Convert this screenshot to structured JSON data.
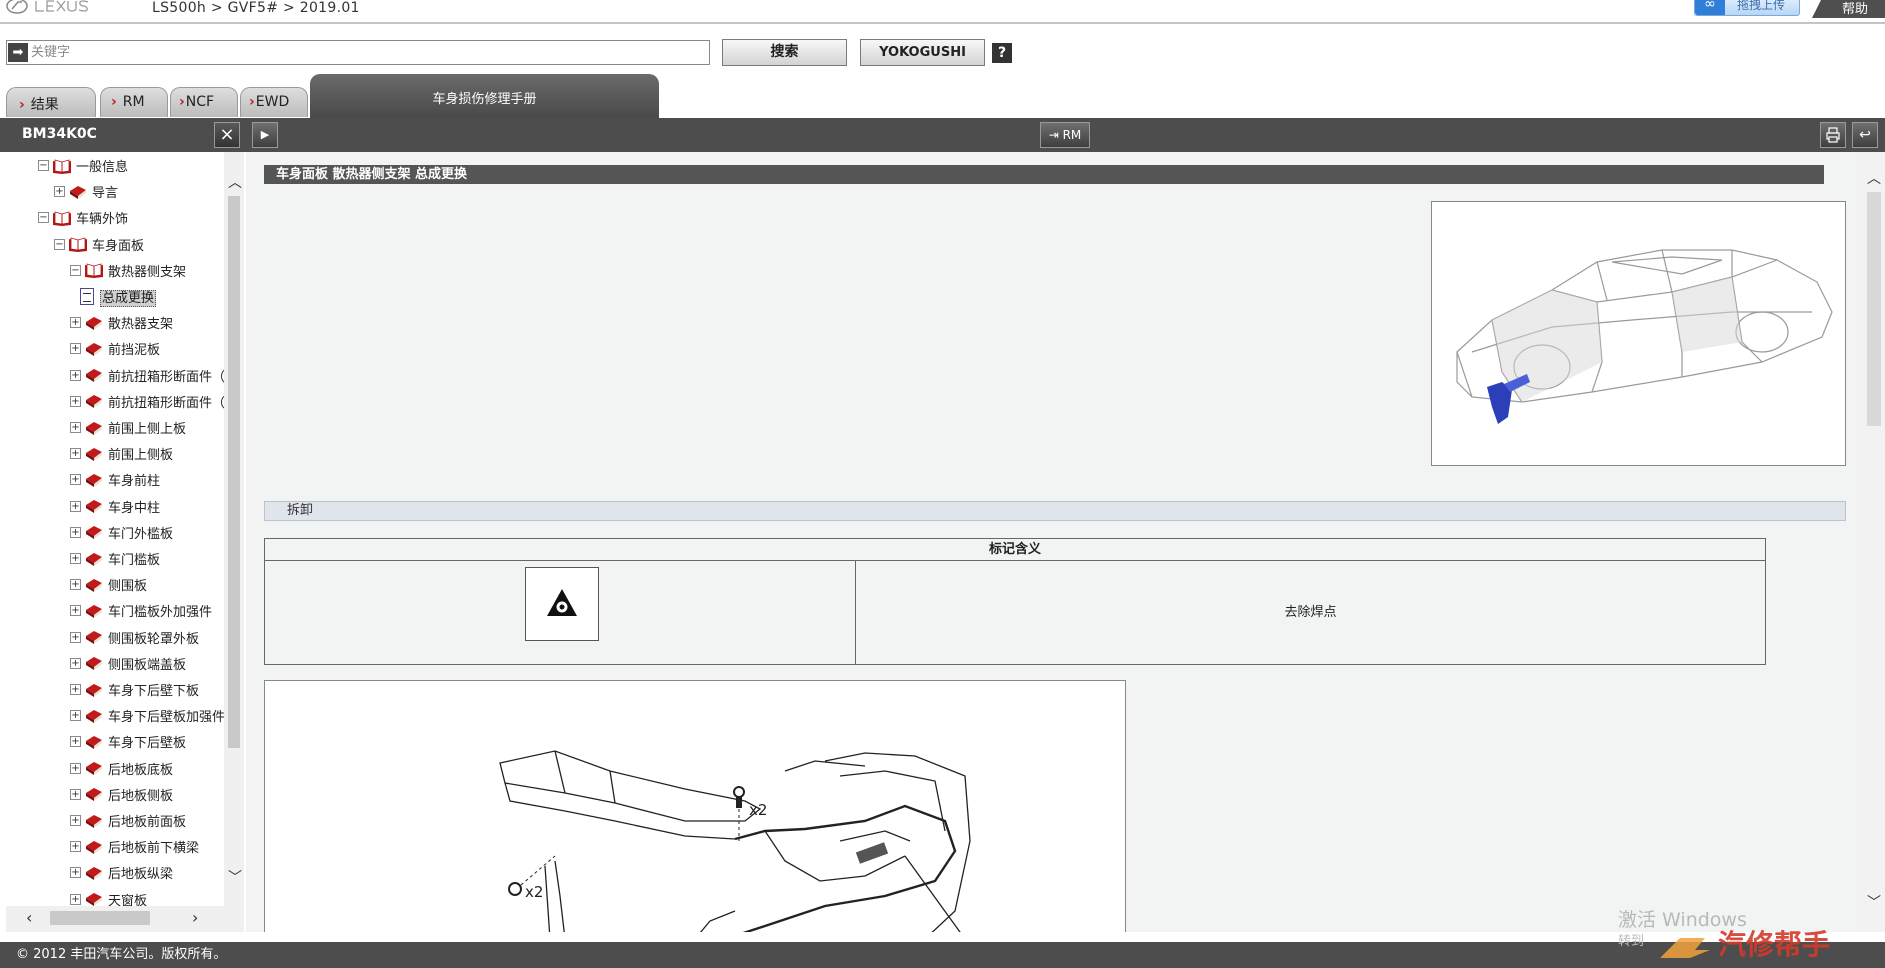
{
  "header": {
    "breadcrumb": "LS500h > GVF5# > 2019.01",
    "upload_label": "拖拽上传",
    "help_label": "帮助"
  },
  "search": {
    "placeholder": "关键字",
    "search_label": "搜索",
    "yokogushi_label": "YOKOGUSHI",
    "question_label": "?"
  },
  "tabs": [
    {
      "label": "结果"
    },
    {
      "label": "RM"
    },
    {
      "label": "NCF"
    },
    {
      "label": "EWD"
    },
    {
      "label": "车身损伤修理手册"
    }
  ],
  "toolbar": {
    "panel_title": "BM34K0C",
    "close_label": "×",
    "rm_label": "RM"
  },
  "tree": [
    {
      "label": "一般信息",
      "level": 1,
      "toggle": "−",
      "icon": "open-book"
    },
    {
      "label": "导言",
      "level": 2,
      "toggle": "+",
      "icon": "closed-book"
    },
    {
      "label": "车辆外饰",
      "level": 1,
      "toggle": "−",
      "icon": "open-book"
    },
    {
      "label": "车身面板",
      "level": 2,
      "toggle": "−",
      "icon": "open-book"
    },
    {
      "label": "散热器侧支架",
      "level": 3,
      "toggle": "−",
      "icon": "open-book"
    },
    {
      "label": "总成更换",
      "level": 4,
      "toggle": "",
      "icon": "document",
      "selected": true
    },
    {
      "label": "散热器支架",
      "level": 3,
      "toggle": "+",
      "icon": "closed-book"
    },
    {
      "label": "前挡泥板",
      "level": 3,
      "toggle": "+",
      "icon": "closed-book"
    },
    {
      "label": "前抗扭箱形断面件（",
      "level": 3,
      "toggle": "+",
      "icon": "closed-book"
    },
    {
      "label": "前抗扭箱形断面件（",
      "level": 3,
      "toggle": "+",
      "icon": "closed-book"
    },
    {
      "label": "前围上侧上板",
      "level": 3,
      "toggle": "+",
      "icon": "closed-book"
    },
    {
      "label": "前围上侧板",
      "level": 3,
      "toggle": "+",
      "icon": "closed-book"
    },
    {
      "label": "车身前柱",
      "level": 3,
      "toggle": "+",
      "icon": "closed-book"
    },
    {
      "label": "车身中柱",
      "level": 3,
      "toggle": "+",
      "icon": "closed-book"
    },
    {
      "label": "车门外槛板",
      "level": 3,
      "toggle": "+",
      "icon": "closed-book"
    },
    {
      "label": "车门槛板",
      "level": 3,
      "toggle": "+",
      "icon": "closed-book"
    },
    {
      "label": "侧围板",
      "level": 3,
      "toggle": "+",
      "icon": "closed-book"
    },
    {
      "label": "车门槛板外加强件",
      "level": 3,
      "toggle": "+",
      "icon": "closed-book"
    },
    {
      "label": "侧围板轮罩外板",
      "level": 3,
      "toggle": "+",
      "icon": "closed-book"
    },
    {
      "label": "侧围板端盖板",
      "level": 3,
      "toggle": "+",
      "icon": "closed-book"
    },
    {
      "label": "车身下后壁下板",
      "level": 3,
      "toggle": "+",
      "icon": "closed-book"
    },
    {
      "label": "车身下后壁板加强件",
      "level": 3,
      "toggle": "+",
      "icon": "closed-book"
    },
    {
      "label": "车身下后壁板",
      "level": 3,
      "toggle": "+",
      "icon": "closed-book"
    },
    {
      "label": "后地板底板",
      "level": 3,
      "toggle": "+",
      "icon": "closed-book"
    },
    {
      "label": "后地板侧板",
      "level": 3,
      "toggle": "+",
      "icon": "closed-book"
    },
    {
      "label": "后地板前面板",
      "level": 3,
      "toggle": "+",
      "icon": "closed-book"
    },
    {
      "label": "后地板前下横梁",
      "level": 3,
      "toggle": "+",
      "icon": "closed-book"
    },
    {
      "label": "后地板纵梁",
      "level": 3,
      "toggle": "+",
      "icon": "closed-book"
    },
    {
      "label": "天窗板",
      "level": 3,
      "toggle": "+",
      "icon": "closed-book"
    }
  ],
  "content": {
    "section_title": "车身面板  散热器侧支架  总成更换",
    "disassembly_label": "拆卸",
    "legend": {
      "header": "标记含义",
      "symbol_icon": "spot-weld-removal-icon",
      "meaning": "去除焊点"
    },
    "diagram_labels": {
      "bolt_qty_top": "x2",
      "bolt_qty_left": "x2"
    }
  },
  "footer": {
    "copyright": "© 2012 丰田汽车公司。版权所有。",
    "watermark_line1": "激活 Windows",
    "watermark_line2": "转到",
    "brand_watermark": "汽修帮手"
  },
  "colors": {
    "toolbar_bg": "#4d4d4d",
    "accent_red": "#c21a1a",
    "highlight_blue": "#2b3fb8"
  }
}
